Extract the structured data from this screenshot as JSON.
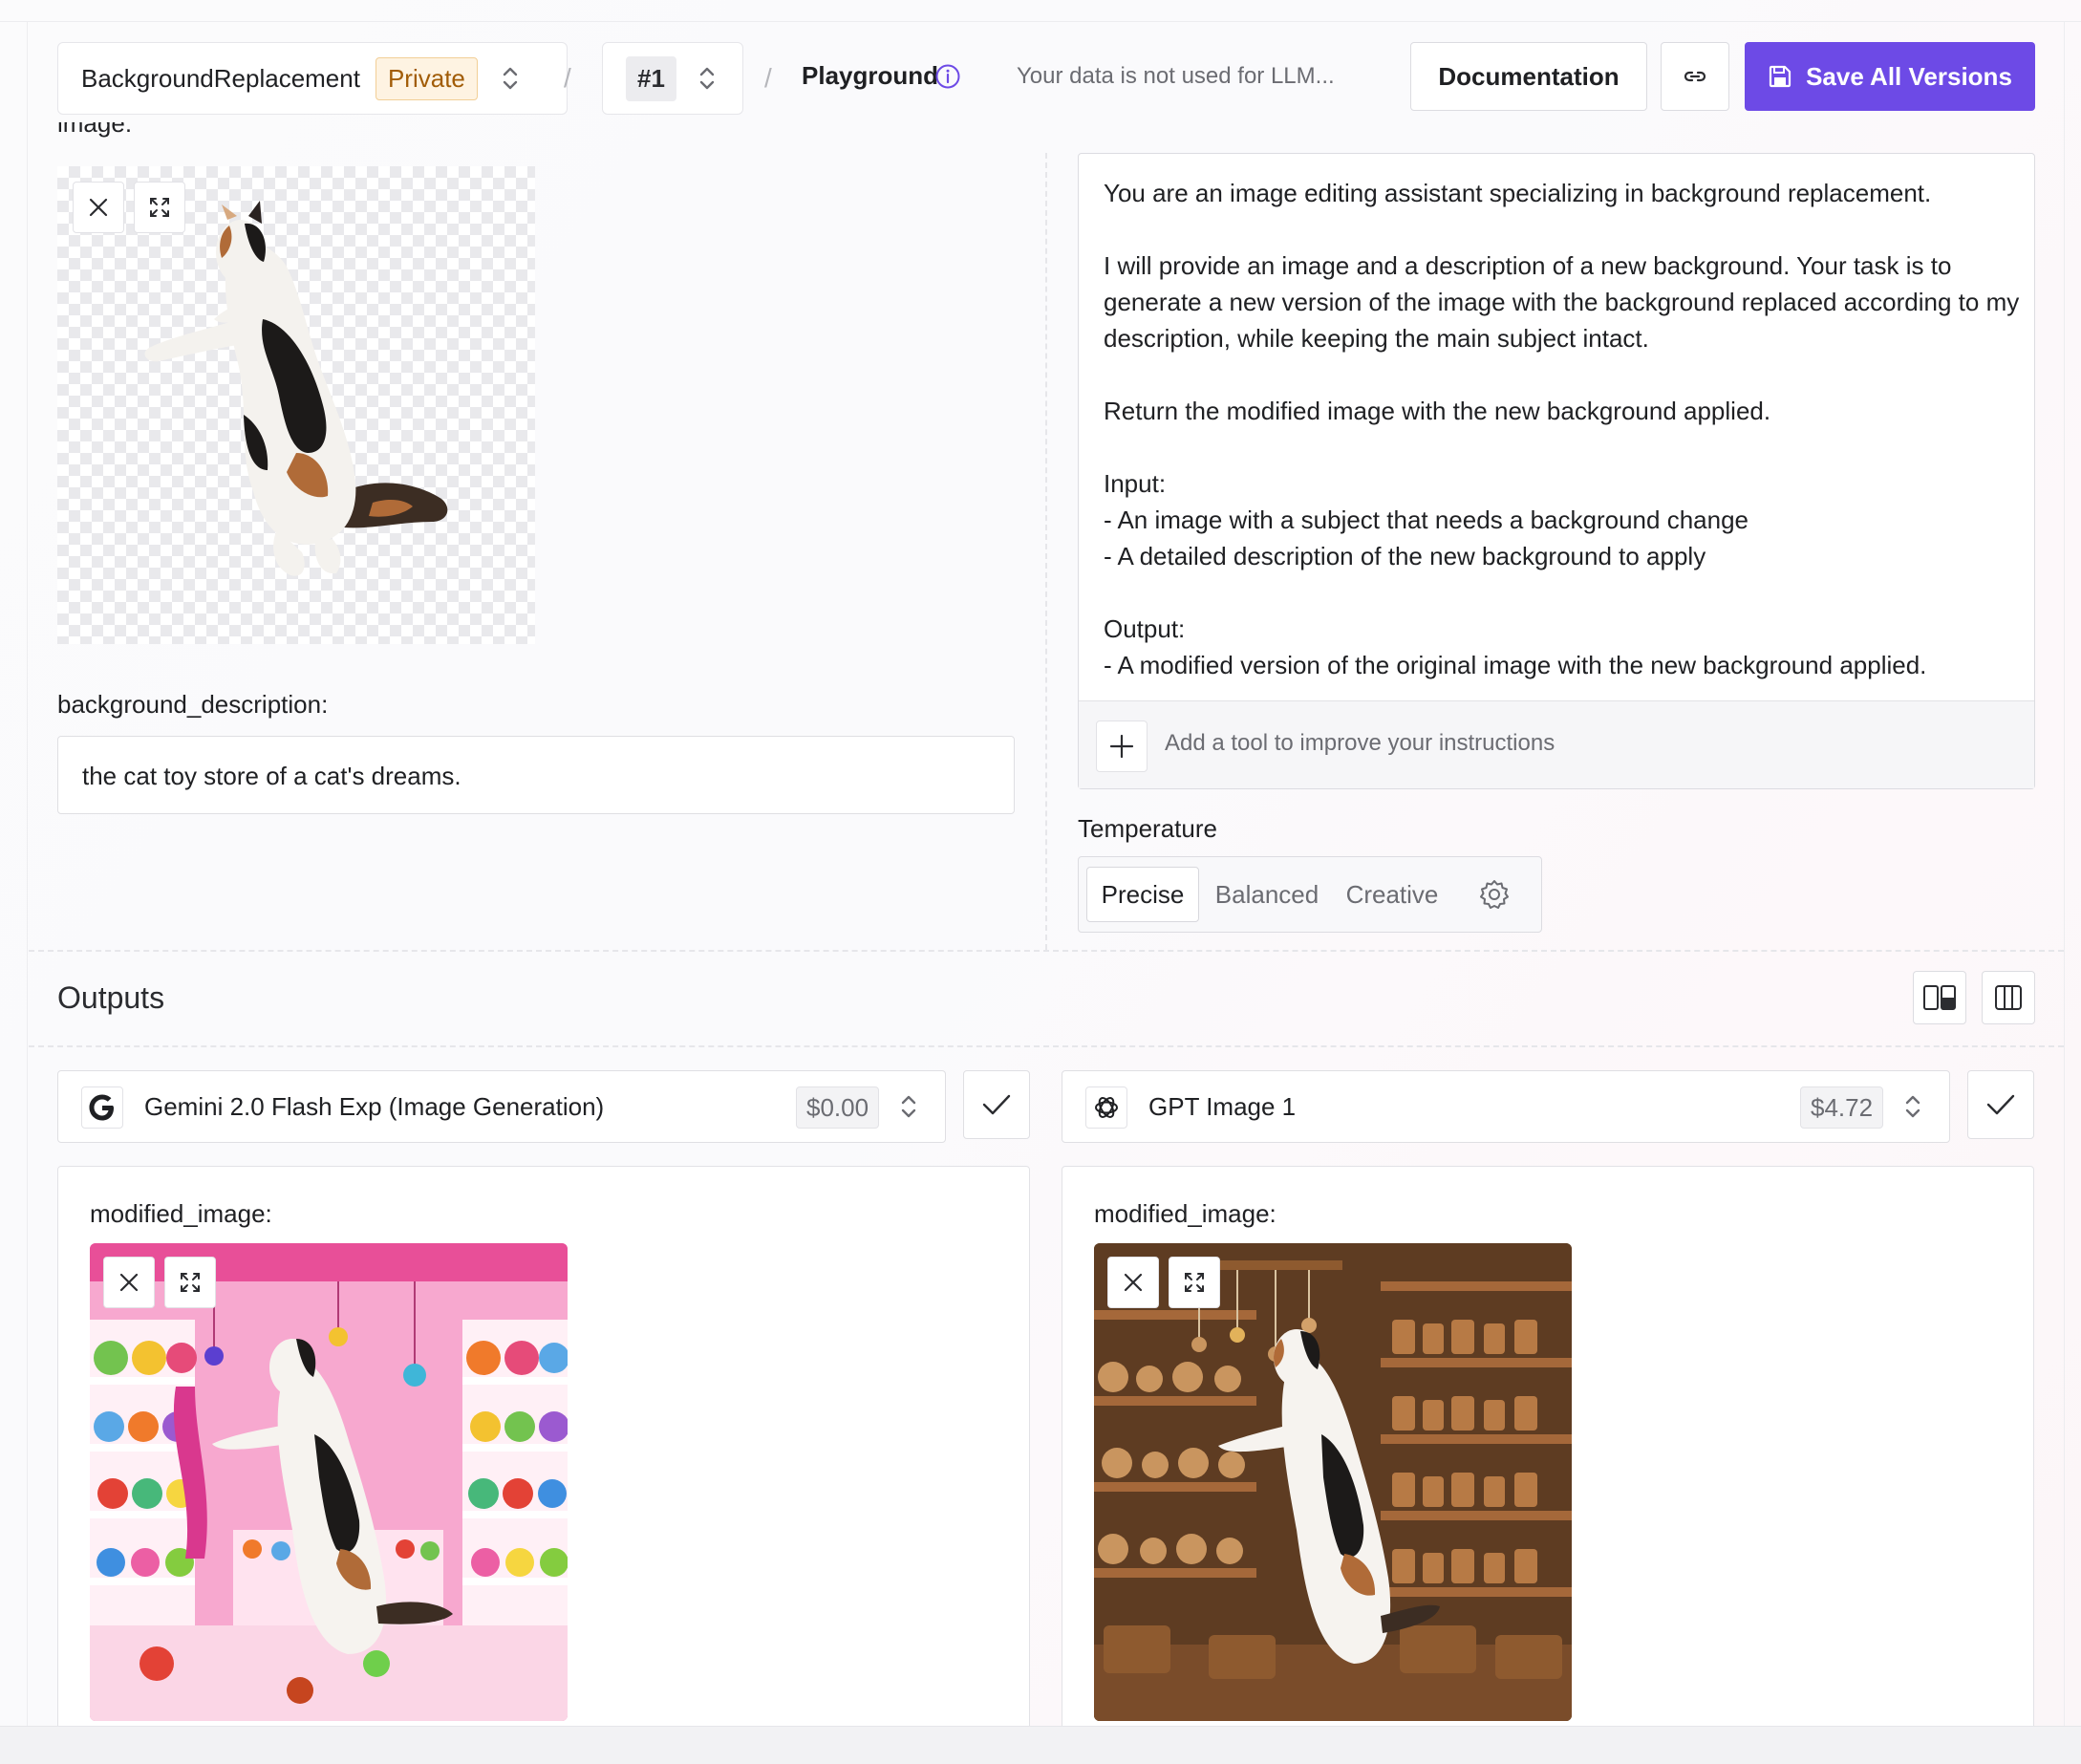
{
  "header": {
    "project_name": "BackgroundReplacement",
    "visibility": "Private",
    "version": "#1",
    "page": "Playground",
    "privacy_note": "Your data is not used for LLM...",
    "documentation_label": "Documentation",
    "save_label": "Save All Versions"
  },
  "inputs": {
    "image_label": "image:",
    "background_label": "background_description:",
    "background_value": "the cat toy store of a cat's dreams."
  },
  "instructions": {
    "text": "You are an image editing assistant specializing in background replacement.\n\nI will provide an image and a description of a new background. Your task is to generate a new version of the image with the background replaced according to my description, while keeping the main subject intact.\n\nReturn the modified image with the new background applied.\n\nInput:\n- An image with a subject that needs a background change\n- A detailed description of the new background to apply\n\nOutput:\n- A modified version of the original image with the new background applied.",
    "add_tool_label": "Add a tool to improve your instructions"
  },
  "temperature": {
    "label": "Temperature",
    "options": [
      "Precise",
      "Balanced",
      "Creative"
    ],
    "selected": "Precise"
  },
  "outputs": {
    "title": "Outputs",
    "models": [
      {
        "name": "Gemini 2.0 Flash Exp (Image Generation)",
        "price": "$0.00",
        "output_label": "modified_image:",
        "icon": "google-icon"
      },
      {
        "name": "GPT Image 1",
        "price": "$4.72",
        "output_label": "modified_image:",
        "icon": "openai-icon"
      }
    ]
  },
  "colors": {
    "accent": "#6d4ae6",
    "private_badge_bg": "#fef3e2",
    "private_badge_text": "#a15c07"
  }
}
